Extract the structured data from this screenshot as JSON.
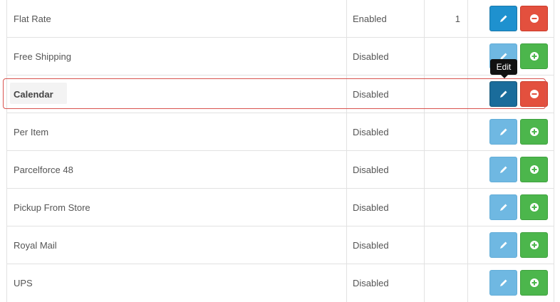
{
  "rows": [
    {
      "name": "Flat Rate",
      "status": "Enabled",
      "sort_order": "1",
      "edit_state": "active",
      "action": "uninstall"
    },
    {
      "name": "Free Shipping",
      "status": "Disabled",
      "sort_order": "",
      "edit_state": "disabled",
      "action": "install"
    },
    {
      "name": "Calendar",
      "status": "Disabled",
      "sort_order": "",
      "edit_state": "hover",
      "action": "uninstall"
    },
    {
      "name": "Per Item",
      "status": "Disabled",
      "sort_order": "",
      "edit_state": "disabled",
      "action": "install"
    },
    {
      "name": "Parcelforce 48",
      "status": "Disabled",
      "sort_order": "",
      "edit_state": "disabled",
      "action": "install"
    },
    {
      "name": "Pickup From Store",
      "status": "Disabled",
      "sort_order": "",
      "edit_state": "disabled",
      "action": "install"
    },
    {
      "name": "Royal Mail",
      "status": "Disabled",
      "sort_order": "",
      "edit_state": "disabled",
      "action": "install"
    },
    {
      "name": "UPS",
      "status": "Disabled",
      "sort_order": "",
      "edit_state": "disabled",
      "action": "install"
    }
  ],
  "tooltip": {
    "text": "Edit"
  },
  "icons": {
    "edit": "pencil-icon",
    "uninstall": "minus-circle-icon",
    "install": "plus-circle-icon"
  },
  "colors": {
    "primary": "#1e91cf",
    "primary_disabled": "#6fb8e2",
    "primary_hover": "#1a6c9b",
    "danger": "#e3503e",
    "success": "#4cb64c",
    "highlight_border": "#d9534f"
  }
}
